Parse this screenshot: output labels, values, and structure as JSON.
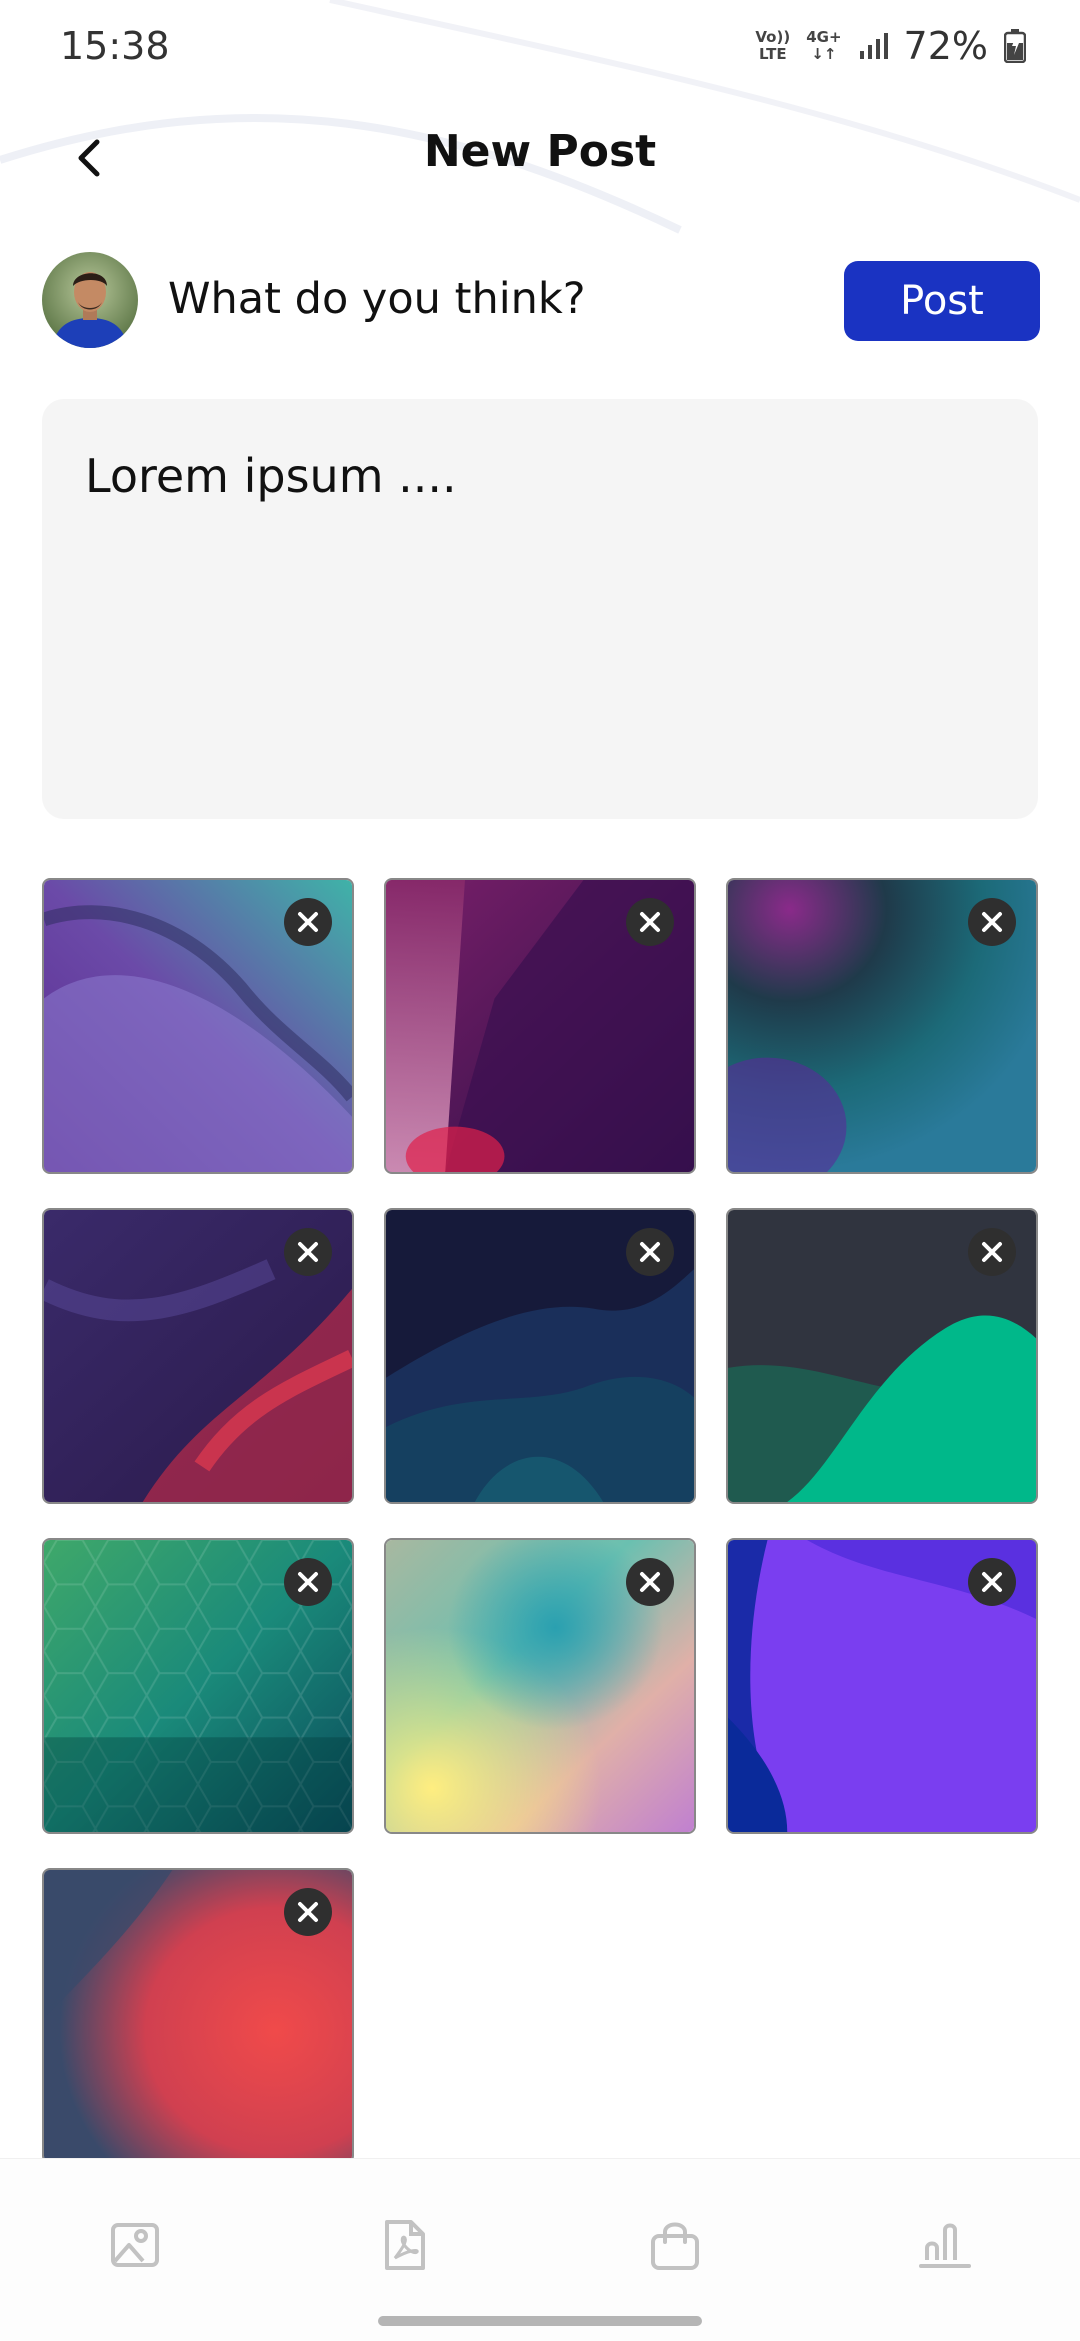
{
  "status_bar": {
    "time": "15:38",
    "volte_top": "Vo))",
    "volte_bottom": "LTE",
    "network_top": "4G+",
    "network_bottom": "↓↑",
    "battery": "72%",
    "icons": [
      "signal-icon",
      "battery-icon"
    ]
  },
  "header": {
    "title": "New Post",
    "back_icon": "chevron-left-icon"
  },
  "composer": {
    "prompt": "What do you think?",
    "post_label": "Post",
    "text": "Lorem ipsum ....",
    "accent_color": "#1a33c2"
  },
  "attachments": [
    {
      "name": "purple-teal-silk",
      "remove_icon": "close-icon"
    },
    {
      "name": "magenta-red-beam",
      "remove_icon": "close-icon"
    },
    {
      "name": "purple-teal-blur",
      "remove_icon": "close-icon"
    },
    {
      "name": "purple-red-waves",
      "remove_icon": "close-icon"
    },
    {
      "name": "navy-waves",
      "remove_icon": "close-icon"
    },
    {
      "name": "dark-green-wave",
      "remove_icon": "close-icon"
    },
    {
      "name": "green-hexagons",
      "remove_icon": "close-icon"
    },
    {
      "name": "pastel-gradient",
      "remove_icon": "close-icon"
    },
    {
      "name": "blue-violet-curve",
      "remove_icon": "close-icon"
    },
    {
      "name": "slate-red-blur",
      "remove_icon": "close-icon"
    }
  ],
  "bottom_nav": {
    "items": [
      "image-icon",
      "pdf-icon",
      "shopping-bag-icon",
      "chart-icon"
    ]
  }
}
